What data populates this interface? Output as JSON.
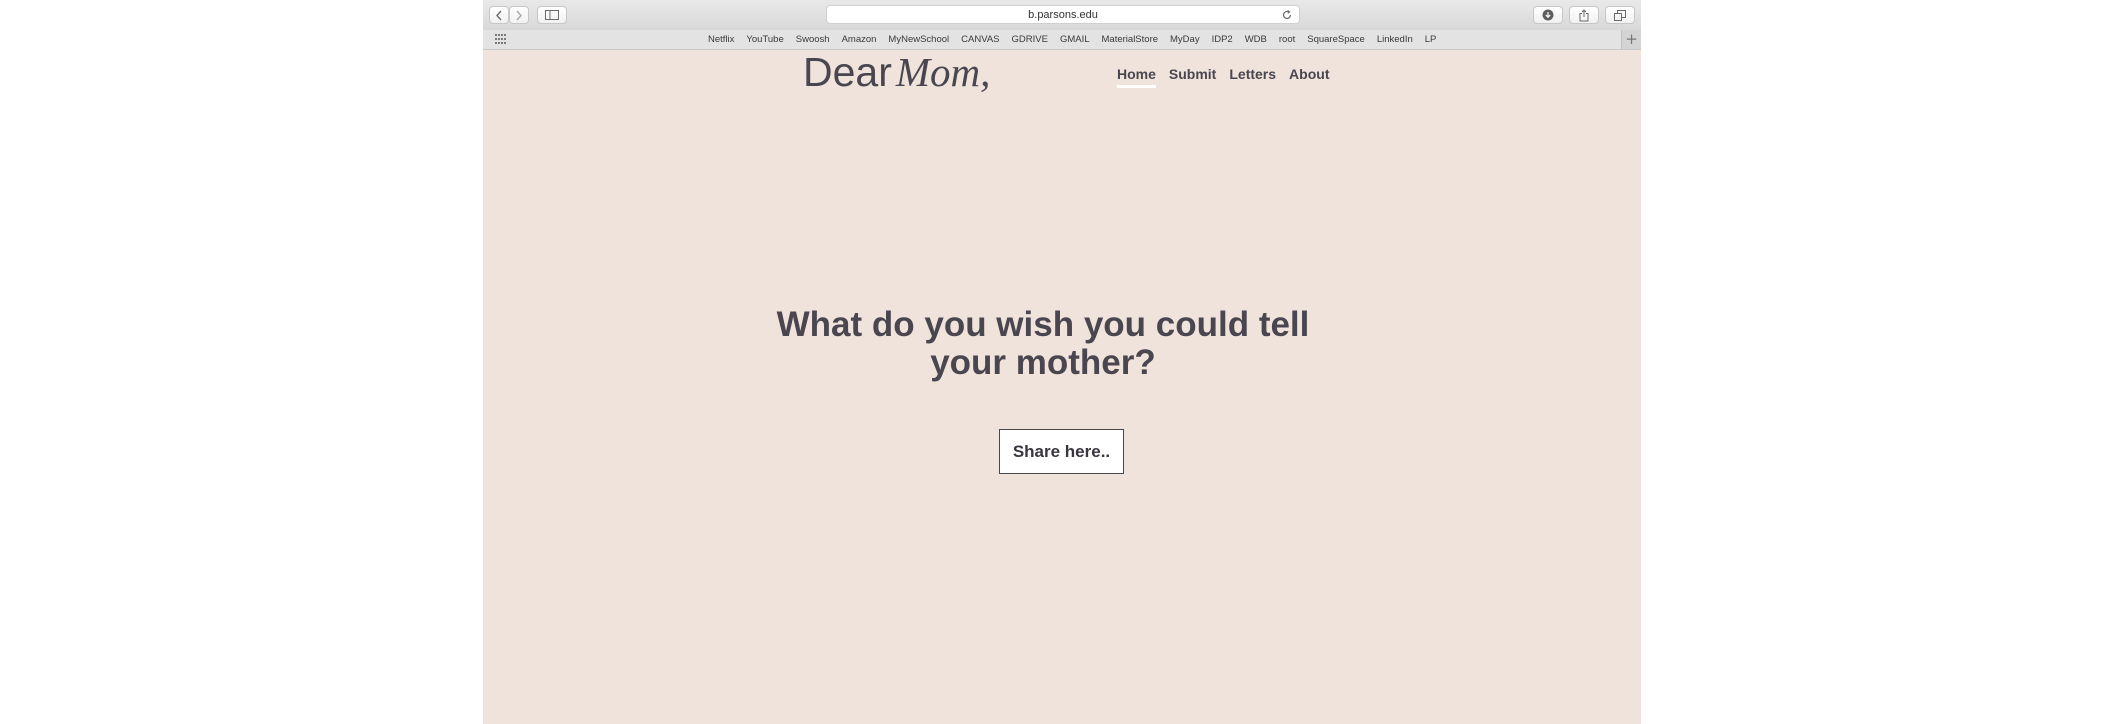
{
  "browser": {
    "url": "b.parsons.edu",
    "bookmarks": [
      "Netflix",
      "YouTube",
      "Swoosh",
      "Amazon",
      "MyNewSchool",
      "CANVAS",
      "GDRIVE",
      "GMAIL",
      "MaterialStore",
      "MyDay",
      "IDP2",
      "WDB",
      "root",
      "SquareSpace",
      "LinkedIn",
      "LP"
    ]
  },
  "site": {
    "logo_dear": "Dear",
    "logo_mom": "Mom,",
    "nav": [
      "Home",
      "Submit",
      "Letters",
      "About"
    ],
    "active_nav": "Home",
    "headline_line1": "What do you wish you could tell",
    "headline_line2": "your mother?",
    "cta": "Share here.."
  },
  "colors": {
    "page_background": "#f0e3db",
    "text": "#4a4650"
  },
  "icons": [
    "back-icon",
    "forward-icon",
    "sidebar-icon",
    "reload-icon",
    "download-icon",
    "share-icon",
    "tabs-icon",
    "bookmarks-grid-icon",
    "add-bookmark-icon"
  ]
}
